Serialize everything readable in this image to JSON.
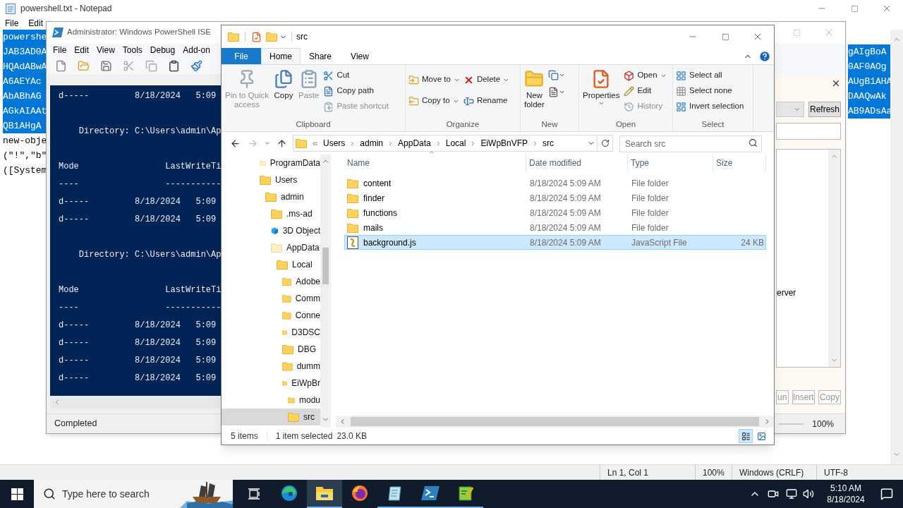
{
  "notepad": {
    "title": "powershell.txt - Notepad",
    "menu": [
      "File",
      "Edit"
    ],
    "left_lines": [
      {
        "text": "powershe",
        "selected": true
      },
      {
        "text": "JAB3AD0A",
        "selected": true
      },
      {
        "text": "HQAdABwA",
        "selected": true
      },
      {
        "text": "A6AEYAc",
        "selected": true
      },
      {
        "text": "AbABhAG",
        "selected": true
      },
      {
        "text": "AGkAIAAt",
        "selected": true
      },
      {
        "text": "QB1AHgA",
        "selected": true
      },
      {
        "text": "new-obje",
        "selected": false
      },
      {
        "text": "(\"!\",\"b\"",
        "selected": false
      },
      {
        "text": "([System",
        "selected": false
      }
    ],
    "right_lines": [
      {
        "text": "gAIgBoA",
        "selected": true
      },
      {
        "text": "0AF0AOg",
        "selected": true
      },
      {
        "text": "AUgB1AHA",
        "selected": true
      },
      {
        "text": "DAAQwAk",
        "selected": true
      },
      {
        "text": "AB9ADsAa",
        "selected": true
      }
    ],
    "status": [
      "Ln 1, Col 1",
      "100%",
      "Windows (CRLF)",
      "UTF-8"
    ]
  },
  "ise": {
    "title": "Administrator: Windows PowerShell ISE",
    "menu": [
      "File",
      "Edit",
      "View",
      "Tools",
      "Debug",
      "Add-on"
    ],
    "console": [
      {
        "kind": "text",
        "text": "d-----         8/18/2024   5:09"
      },
      {
        "kind": "blank"
      },
      {
        "kind": "text",
        "text": "    Directory: C:\\Users\\admin\\Ap"
      },
      {
        "kind": "blank"
      },
      {
        "kind": "text",
        "text": "Mode                 LastWriteTi"
      },
      {
        "kind": "text",
        "text": "----                 -----------"
      },
      {
        "kind": "text",
        "text": "d-----         8/18/2024   5:09"
      },
      {
        "kind": "text",
        "text": "d-----         8/18/2024   5:09"
      },
      {
        "kind": "blank"
      },
      {
        "kind": "text",
        "text": "    Directory: C:\\Users\\admin\\Ap"
      },
      {
        "kind": "blank"
      },
      {
        "kind": "text",
        "text": "Mode                 LastWriteTi"
      },
      {
        "kind": "text",
        "text": "----                 -----------"
      },
      {
        "kind": "text",
        "text": "d-----         8/18/2024   5:09"
      },
      {
        "kind": "text",
        "text": "d-----         8/18/2024   5:09"
      },
      {
        "kind": "text",
        "text": "d-----         8/18/2024   5:09"
      },
      {
        "kind": "text",
        "text": "d-----         8/18/2024   5:09"
      }
    ],
    "addon": {
      "action": "Refresh",
      "list_text": "erver",
      "buttons": [
        "un",
        "Insert",
        "Copy"
      ],
      "zoom": "100%"
    },
    "status": "Completed"
  },
  "explorer": {
    "title": "src",
    "tabs": [
      {
        "label": "File",
        "kind": "menu",
        "selected": false
      },
      {
        "label": "Home",
        "kind": "tab",
        "selected": true
      },
      {
        "label": "Share",
        "kind": "tab",
        "selected": false
      },
      {
        "label": "View",
        "kind": "tab",
        "selected": false
      }
    ],
    "ribbon": [
      {
        "label": "Clipboard",
        "items": [
          {
            "label": "Pin to Quick access",
            "kind": "large",
            "disabled": true,
            "dropdown": false
          },
          {
            "label": "Copy",
            "kind": "large",
            "disabled": false,
            "dropdown": false
          },
          {
            "label": "Paste",
            "kind": "large",
            "disabled": true,
            "dropdown": false
          },
          {
            "label": "Cut",
            "kind": "small",
            "disabled": false,
            "dropdown": false
          },
          {
            "label": "Copy path",
            "kind": "small",
            "disabled": false,
            "dropdown": false
          },
          {
            "label": "Paste shortcut",
            "kind": "small",
            "disabled": true,
            "dropdown": false
          }
        ]
      },
      {
        "label": "Organize",
        "items": [
          {
            "label": "Move to",
            "kind": "small",
            "disabled": false,
            "dropdown": true
          },
          {
            "label": "Copy to",
            "kind": "small",
            "disabled": false,
            "dropdown": true
          },
          {
            "label": "Delete",
            "kind": "small",
            "disabled": false,
            "dropdown": true
          },
          {
            "label": "Rename",
            "kind": "small",
            "disabled": false,
            "dropdown": false
          }
        ]
      },
      {
        "label": "New",
        "items": [
          {
            "label": "New folder",
            "kind": "large",
            "disabled": false,
            "dropdown": false
          },
          {
            "kind": "icon",
            "disabled": false,
            "dropdown": true
          },
          {
            "kind": "icon",
            "disabled": false,
            "dropdown": true
          }
        ]
      },
      {
        "label": "Open",
        "items": [
          {
            "label": "Properties",
            "kind": "large",
            "disabled": false,
            "dropdown": true
          },
          {
            "label": "Open",
            "kind": "small",
            "disabled": false,
            "dropdown": true
          },
          {
            "label": "Edit",
            "kind": "small",
            "disabled": false,
            "dropdown": false
          },
          {
            "label": "History",
            "kind": "small",
            "disabled": true,
            "dropdown": false
          }
        ]
      },
      {
        "label": "Select",
        "items": [
          {
            "label": "Select all",
            "kind": "small",
            "disabled": false,
            "dropdown": false
          },
          {
            "label": "Select none",
            "kind": "small",
            "disabled": false,
            "dropdown": false
          },
          {
            "label": "Invert selection",
            "kind": "small",
            "disabled": false,
            "dropdown": false
          }
        ]
      }
    ],
    "breadcrumb": [
      "Users",
      "admin",
      "AppData",
      "Local",
      "EiWpBnVFP",
      "src"
    ],
    "search": {
      "placeholder": "Search src"
    },
    "tree": [
      {
        "name": "ProgramData",
        "kind": "hidden_folder",
        "selected": false
      },
      {
        "name": "Users",
        "kind": "folder",
        "selected": false,
        "children": [
          {
            "name": "admin",
            "kind": "folder",
            "selected": false,
            "children": [
              {
                "name": ".ms-ad",
                "kind": "folder",
                "selected": false
              },
              {
                "name": "3D Object",
                "kind": "objects",
                "selected": false
              },
              {
                "name": "AppData",
                "kind": "hidden_folder",
                "selected": false,
                "children": [
                  {
                    "name": "Local",
                    "kind": "folder",
                    "selected": false,
                    "children": [
                      {
                        "name": "Adobe",
                        "kind": "folder",
                        "selected": false
                      },
                      {
                        "name": "Comm",
                        "kind": "folder",
                        "selected": false
                      },
                      {
                        "name": "Conne",
                        "kind": "folder",
                        "selected": false
                      },
                      {
                        "name": "D3DSC",
                        "kind": "folder",
                        "selected": false
                      },
                      {
                        "name": "DBG",
                        "kind": "folder",
                        "selected": false
                      },
                      {
                        "name": "dumm",
                        "kind": "folder",
                        "selected": false
                      },
                      {
                        "name": "EiWpBr",
                        "kind": "folder",
                        "selected": false,
                        "children": [
                          {
                            "name": "modu",
                            "kind": "folder",
                            "selected": false
                          },
                          {
                            "name": "src",
                            "kind": "folder",
                            "selected": true
                          }
                        ]
                      }
                    ]
                  }
                ]
              }
            ]
          }
        ]
      }
    ],
    "columns": [
      "Name",
      "Date modified",
      "Type",
      "Size"
    ],
    "files": [
      {
        "name": "content",
        "date": "8/18/2024 5:09 AM",
        "type": "File folder",
        "kind": "folder",
        "selected": false
      },
      {
        "name": "finder",
        "date": "8/18/2024 5:09 AM",
        "type": "File folder",
        "kind": "folder",
        "selected": false
      },
      {
        "name": "functions",
        "date": "8/18/2024 5:09 AM",
        "type": "File folder",
        "kind": "folder",
        "selected": false
      },
      {
        "name": "mails",
        "date": "8/18/2024 5:09 AM",
        "type": "File folder",
        "kind": "folder",
        "selected": false
      },
      {
        "name": "background.js",
        "date": "8/18/2024 5:09 AM",
        "type": "JavaScript File",
        "size": "24 KB",
        "kind": "script",
        "selected": true
      }
    ],
    "status": {
      "count": "5 items",
      "selection": "1 item selected",
      "size": "23.0 KB"
    }
  },
  "taskbar": {
    "search": {
      "placeholder": "Type here to search"
    },
    "apps": [
      {
        "kind": "edge",
        "running": false,
        "active": false
      },
      {
        "kind": "explorer",
        "running": true,
        "active": true
      },
      {
        "kind": "firefox",
        "running": false,
        "active": false
      },
      {
        "kind": "notepad_alt",
        "running": true,
        "active": false
      },
      {
        "kind": "powershell",
        "running": true,
        "active": false
      },
      {
        "kind": "notepad",
        "running": true,
        "active": false
      }
    ],
    "time": "5:10 AM",
    "date": "8/18/2024"
  }
}
